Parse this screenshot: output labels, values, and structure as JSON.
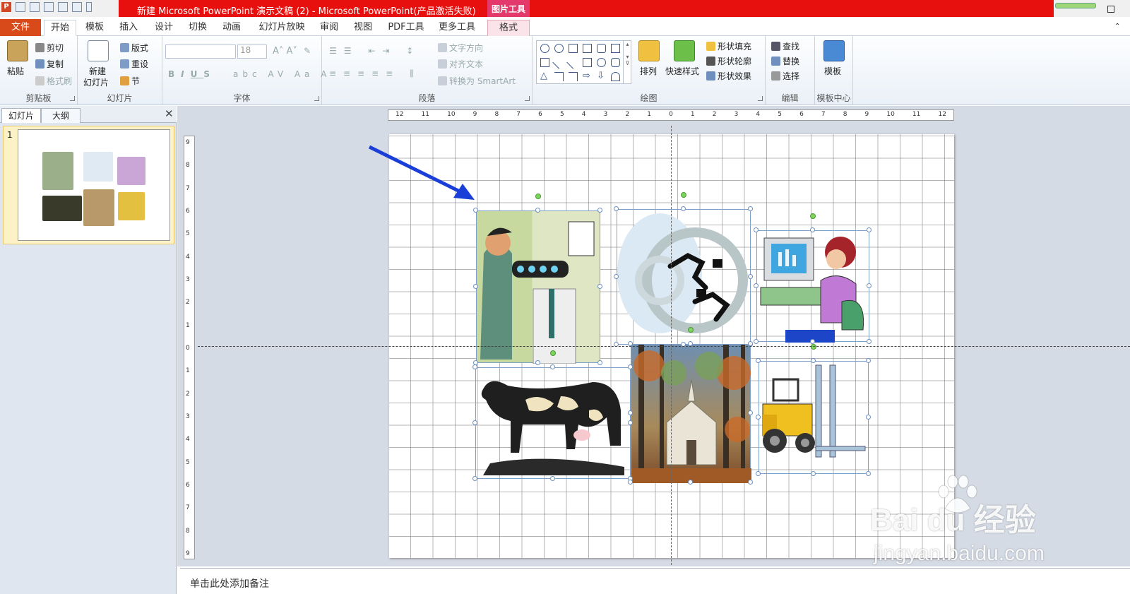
{
  "window": {
    "title": "新建 Microsoft PowerPoint 演示文稿 (2) - Microsoft PowerPoint(产品激活失败)",
    "contextual_tab_group": "图片工具"
  },
  "tabs": [
    {
      "label": "文件",
      "active": false
    },
    {
      "label": "开始",
      "active": true
    },
    {
      "label": "模板",
      "active": false
    },
    {
      "label": "插入",
      "active": false
    },
    {
      "label": "设计",
      "active": false
    },
    {
      "label": "切换",
      "active": false
    },
    {
      "label": "动画",
      "active": false
    },
    {
      "label": "幻灯片放映",
      "active": false
    },
    {
      "label": "审阅",
      "active": false
    },
    {
      "label": "视图",
      "active": false
    },
    {
      "label": "PDF工具",
      "active": false
    },
    {
      "label": "更多工具",
      "active": false
    },
    {
      "label": "格式",
      "active": false
    }
  ],
  "ribbon": {
    "clipboard": {
      "group_label": "剪贴板",
      "paste": "粘贴",
      "cut": "剪切",
      "copy": "复制",
      "format_painter": "格式刷"
    },
    "slides": {
      "group_label": "幻灯片",
      "new_slide_line1": "新建",
      "new_slide_line2": "幻灯片",
      "layout": "版式",
      "reset": "重设",
      "section": "节"
    },
    "font": {
      "group_label": "字体",
      "font_name": "",
      "font_size": "18"
    },
    "paragraph": {
      "group_label": "段落",
      "text_direction": "文字方向",
      "align_text": "对齐文本",
      "convert_smartart": "转换为 SmartArt"
    },
    "drawing": {
      "group_label": "绘图",
      "arrange": "排列",
      "quick_styles": "快速样式",
      "shape_fill": "形状填充",
      "shape_outline": "形状轮廓",
      "shape_effects": "形状效果"
    },
    "editing": {
      "group_label": "编辑",
      "find": "查找",
      "replace": "替换",
      "select": "选择"
    },
    "template_center": {
      "group_label": "模板中心",
      "template": "模板"
    }
  },
  "left_panel": {
    "tabs": [
      {
        "label": "幻灯片",
        "active": true
      },
      {
        "label": "大纲",
        "active": false
      }
    ],
    "close_icon": "close-icon",
    "slides": [
      {
        "number": "1",
        "selected": true
      }
    ]
  },
  "rulers": {
    "horizontal_ticks": [
      "12",
      "11",
      "10",
      "9",
      "8",
      "7",
      "6",
      "5",
      "4",
      "3",
      "2",
      "1",
      "0",
      "1",
      "2",
      "3",
      "4",
      "5",
      "6",
      "7",
      "8",
      "9",
      "10",
      "11",
      "12"
    ],
    "vertical_ticks": [
      "9",
      "8",
      "7",
      "6",
      "5",
      "4",
      "3",
      "2",
      "1",
      "0",
      "1",
      "2",
      "3",
      "4",
      "5",
      "6",
      "7",
      "8",
      "9"
    ]
  },
  "slide": {
    "pictures": [
      {
        "name": "eye-doctor-clipart",
        "selected": true
      },
      {
        "name": "business-gears-clipart",
        "selected": true
      },
      {
        "name": "woman-computer-clipart",
        "selected": true
      },
      {
        "name": "cow-clipart",
        "selected": true
      },
      {
        "name": "church-forest-clipart",
        "selected": true
      },
      {
        "name": "forklift-clipart",
        "selected": true
      }
    ],
    "annotation": "arrow-pointer"
  },
  "notes": {
    "placeholder": "单击此处添加备注"
  },
  "watermark": {
    "logo": "Bai du 经验",
    "url": "jingyan.baidu.com"
  },
  "colors": {
    "accent_red": "#e8100e",
    "file_tab": "#d94a1a",
    "contextual_pink": "#e43a6b",
    "arrow_blue": "#1a3fd8",
    "selected_slide": "#fdf2c6"
  }
}
